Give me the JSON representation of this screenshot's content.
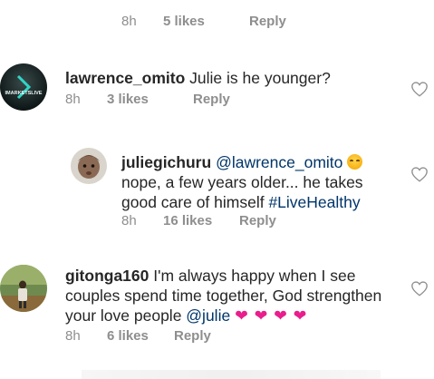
{
  "top_meta": {
    "time": "8h",
    "likes": "5 likes",
    "reply": "Reply"
  },
  "comments": [
    {
      "username": "lawrence_omito",
      "text": "Julie is he younger?",
      "avatar_text": "IMARKETSLIVE",
      "time": "8h",
      "likes": "3 likes",
      "reply": "Reply"
    },
    {
      "username": "juliegichuru",
      "mention": "@lawrence_omito",
      "line1": "nope, a few years older... he takes",
      "line2": "good care of himself ",
      "hashtag": "#LiveHealthy",
      "time": "8h",
      "likes": "16 likes",
      "reply": "Reply"
    },
    {
      "username": "gitonga160",
      "line1": "I'm always happy when I see",
      "line2": "couples spend time together, God strengthen",
      "line3": "your love people ",
      "mention": "@julie",
      "hearts": "❤ ❤ ❤ ❤",
      "time": "8h",
      "likes": "6 likes",
      "reply": "Reply"
    }
  ],
  "icons": [
    "like-heart-icon",
    "smiling-emoji-icon",
    "pink-heart-emoji-icon"
  ],
  "colors": {
    "link": "#003569",
    "meta": "#8e8e8e",
    "text": "#262626",
    "heart_emoji": "#e91e8c"
  }
}
